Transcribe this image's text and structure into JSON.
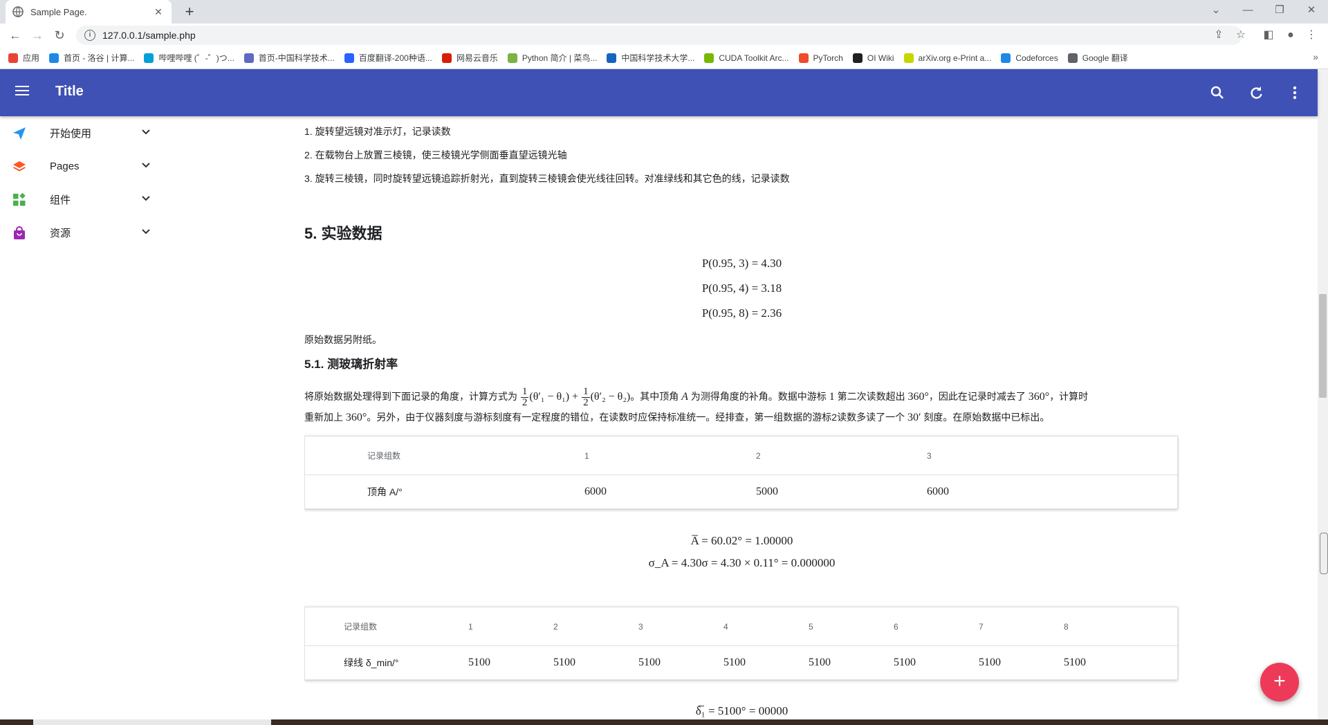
{
  "browser": {
    "tab_title": "Sample Page.",
    "tab_close": "✕",
    "new_tab": "+",
    "url": "127.0.0.1/sample.php",
    "bookmarks": [
      {
        "label": "应用",
        "color": "#ea4335"
      },
      {
        "label": "首页 - 洛谷 | 计算...",
        "color": "#1e88e5"
      },
      {
        "label": "哔哩哔哩 (゜-゜)つ...",
        "color": "#00a1d6"
      },
      {
        "label": "首页-中国科学技术...",
        "color": "#5c6bc0"
      },
      {
        "label": "百度翻译-200种语...",
        "color": "#2962ff"
      },
      {
        "label": "网易云音乐",
        "color": "#d81e06"
      },
      {
        "label": "Python 简介 | 菜鸟...",
        "color": "#7cb342"
      },
      {
        "label": "中国科学技术大学...",
        "color": "#1565c0"
      },
      {
        "label": "CUDA Toolkit Arc...",
        "color": "#76b900"
      },
      {
        "label": "PyTorch",
        "color": "#ee4c2c"
      },
      {
        "label": "OI Wiki",
        "color": "#212121"
      },
      {
        "label": "arXiv.org e-Print a...",
        "color": "#c6d600"
      },
      {
        "label": "Codeforces",
        "color": "#1e88e5"
      },
      {
        "label": "Google 翻译",
        "color": "#5f6368"
      }
    ],
    "bookmarks_more": "»"
  },
  "appbar": {
    "title": "Title",
    "icons": [
      "menu-icon",
      "search-icon",
      "refresh-icon",
      "more-vert-icon"
    ],
    "color": "#3f51b5"
  },
  "sidebar": {
    "items": [
      {
        "label": "开始使用",
        "icon": "send-icon"
      },
      {
        "label": "Pages",
        "icon": "layers-icon"
      },
      {
        "label": "组件",
        "icon": "widgets-icon"
      },
      {
        "label": "资源",
        "icon": "bag-icon"
      }
    ]
  },
  "content": {
    "steps": [
      "1. 旋转望远镜对准示灯，记录读数",
      "2. 在载物台上放置三棱镜，使三棱镜光学侧面垂直望远镜光轴",
      "3. 旋转三棱镜，同时旋转望远镜追踪折射光，直到旋转三棱镜会使光线往回转。对准绿线和其它色的线，记录读数"
    ],
    "section_title": "5. 实验数据",
    "p_values": [
      "P(0.95, 3) = 4.30",
      "P(0.95, 4) = 3.18",
      "P(0.95, 8) = 2.36"
    ],
    "raw_note": "原始数据另附纸。",
    "subsection_title": "5.1. 测玻璃折射率",
    "para1": {
      "intro": "将原始数据处理得到下面记录的角度，计算方式为 ",
      "frac_num": "1",
      "frac_den": "2",
      "term1": "(θ′₁ − θ₁) + ",
      "term2": "(θ′₂ − θ₂)",
      "rest1": "。其中顶角 ",
      "sym_A": "A",
      "rest2": " 为测得角度的补角。数据中游标 ",
      "one": "1",
      "rest3": " 第二次读数超出 ",
      "deg360": "360°",
      "rest4": "，因此在记录时减去了 ",
      "rest5": "，计算时"
    },
    "para2": {
      "start": "重新加上 ",
      "deg360": "360°",
      "rest1": "。另外，由于仪器刻度与游标刻度有一定程度的错位，在读数时应保持标准统一。经排查，第一组数据的游标2读数多读了一个 ",
      "min30": "30′",
      "rest2": " 刻度。在原始数据中已标出。"
    },
    "table1": {
      "header": [
        "记录组数",
        "1",
        "2",
        "3"
      ],
      "row_label": "顶角 A/°",
      "values": [
        "6000",
        "5000",
        "6000"
      ]
    },
    "eq_A": "A̅ = 60.02° = 1.00000",
    "eq_sigma": "σ_A = 4.30σ = 4.30 × 0.11° = 0.000000",
    "table2": {
      "header": [
        "记录组数",
        "1",
        "2",
        "3",
        "4",
        "5",
        "6",
        "7",
        "8"
      ],
      "row_label": "绿线 δ_min/°",
      "values": [
        "5100",
        "5100",
        "5100",
        "5100",
        "5100",
        "5100",
        "5100",
        "5100"
      ]
    },
    "eq_delta": "δ̅₁ = 5100° = 00000"
  },
  "fab": {
    "label": "+",
    "color": "#ee3a59"
  }
}
